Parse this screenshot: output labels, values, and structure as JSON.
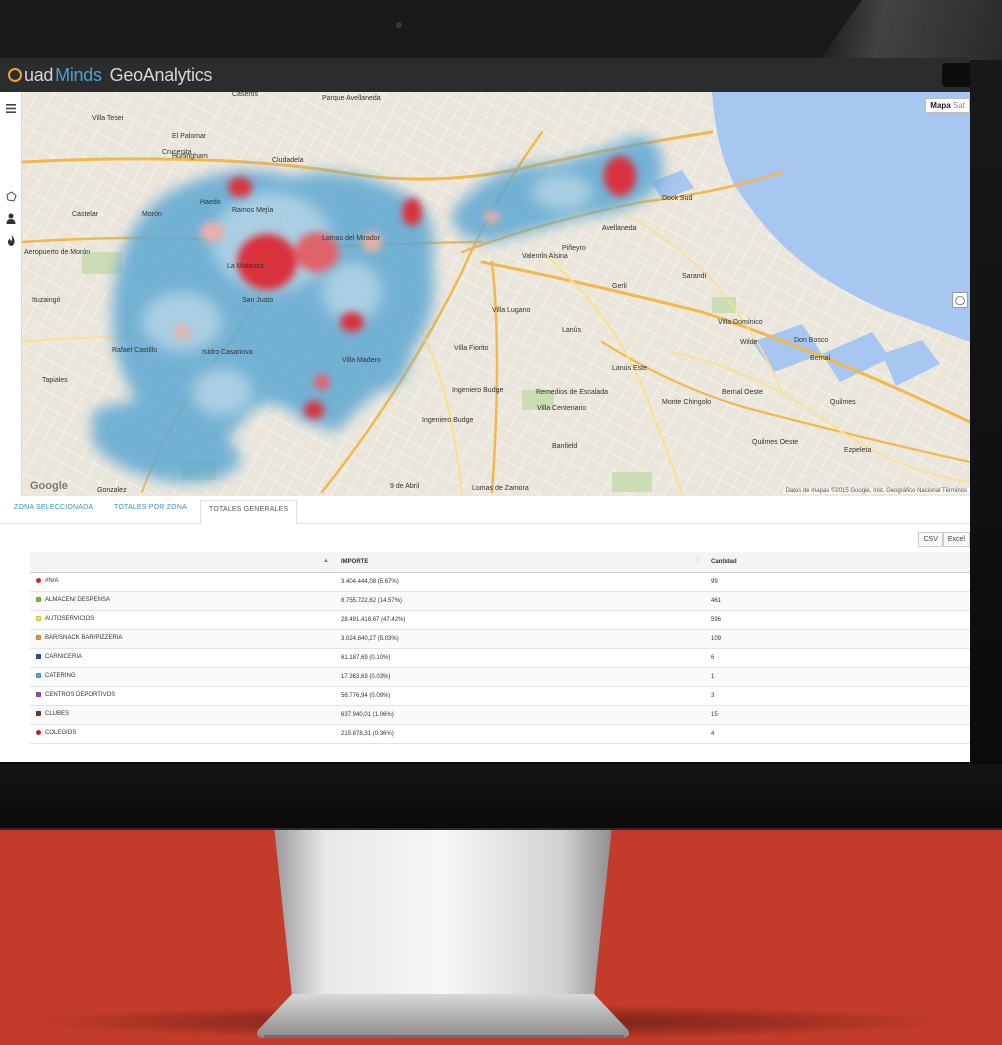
{
  "app": {
    "logo_part1": "uad",
    "logo_part2": "Minds",
    "logo_part3": "GeoAnalytics"
  },
  "map": {
    "type_selected": "Mapa",
    "type_other": "Sat",
    "google": "Google",
    "credit": "Datos de mapas ©2015 Google, Inst. Geográfico Nacional  Términos",
    "places": [
      "Villa Tesei",
      "Hurlingham",
      "El Palomar",
      "Castelar",
      "Morón",
      "Aeropuerto de Morón",
      "Haedo",
      "Ramos Mejía",
      "La Matanza",
      "San Justo",
      "Rafael Castillo",
      "Isidro Casanova",
      "Gonzalez",
      "Valentín Alsina",
      "Piñeyro",
      "Avellaneda",
      "Dock Sud",
      "Sarandí",
      "Gerli",
      "Lanús",
      "Villa Fiorito",
      "Lanús Este",
      "Villa Domínico",
      "Wilde",
      "Don Bosco",
      "Bernal",
      "Remedios de Escalada",
      "Villa Centenario",
      "Ingeniero Budge",
      "Banfield",
      "Monte Chingolo",
      "Bernal Oeste",
      "Quilmes",
      "Quilmes Oeste",
      "Ezpeleta",
      "9 de Abril",
      "Lomas de Zamora",
      "Ingeniero Budge",
      "Tapiales",
      "Villa Madero",
      "Lomas del Mirador",
      "Ituzaingó",
      "Crucecita",
      "Ciudadela",
      "Caseros",
      "Villa Lugano",
      "Parque Avellaneda"
    ]
  },
  "tabs": [
    "ZONA SELECCIONADA",
    "TOTALES POR ZONA",
    "TOTALES GENERALES"
  ],
  "toolbar": {
    "csv": "CSV",
    "excel": "Excel"
  },
  "table": {
    "headers": [
      "",
      "IMPORTE",
      "Cantidad"
    ],
    "rows": [
      {
        "color": "#d9232d",
        "shape": "round",
        "name": "#N/A",
        "importe": "3.404.444,08 (5.67%)",
        "cantidad": "99"
      },
      {
        "color": "#7bbf3a",
        "shape": "square",
        "name": "ALMACEN/ DESPENSA",
        "importe": "8.755.722,62 (14.57%)",
        "cantidad": "461"
      },
      {
        "color": "#f2e24a",
        "shape": "square",
        "name": "AUTOSERVICIOS",
        "importe": "28.491.418,67 (47.42%)",
        "cantidad": "596"
      },
      {
        "color": "#f2913a",
        "shape": "square",
        "name": "BAR/SNACK BAR/PIZZERIA",
        "importe": "3.024.840,27 (5.03%)",
        "cantidad": "109"
      },
      {
        "color": "#2f4fb0",
        "shape": "square",
        "name": "CARNICERIA",
        "importe": "61.187,69 (0.10%)",
        "cantidad": "6"
      },
      {
        "color": "#5aa6d8",
        "shape": "square",
        "name": "CATERING",
        "importe": "17.363,69 (0.03%)",
        "cantidad": "1"
      },
      {
        "color": "#8e4fb5",
        "shape": "square",
        "name": "CENTROS DEPORTIVOS",
        "importe": "56.776,94 (0.09%)",
        "cantidad": "3"
      },
      {
        "color": "#6b3a2a",
        "shape": "square",
        "name": "CLUBES",
        "importe": "637.940,01 (1.06%)",
        "cantidad": "15"
      },
      {
        "color": "#c91c2b",
        "shape": "round",
        "name": "COLEGIOS",
        "importe": "215.878,31 (0.36%)",
        "cantidad": "4"
      }
    ]
  },
  "colors": {
    "brand_blue": "#4aa3d3",
    "logo_orange": "#e8a436",
    "header_bg": "#2b2c2e",
    "backdrop_red": "#c33b2a",
    "heat_low": "#5fa8d3",
    "heat_high": "#d9323e"
  },
  "icons": {
    "sidebar": [
      "menu-icon",
      "polygon-draw-icon",
      "user-icon",
      "fire-icon"
    ]
  }
}
